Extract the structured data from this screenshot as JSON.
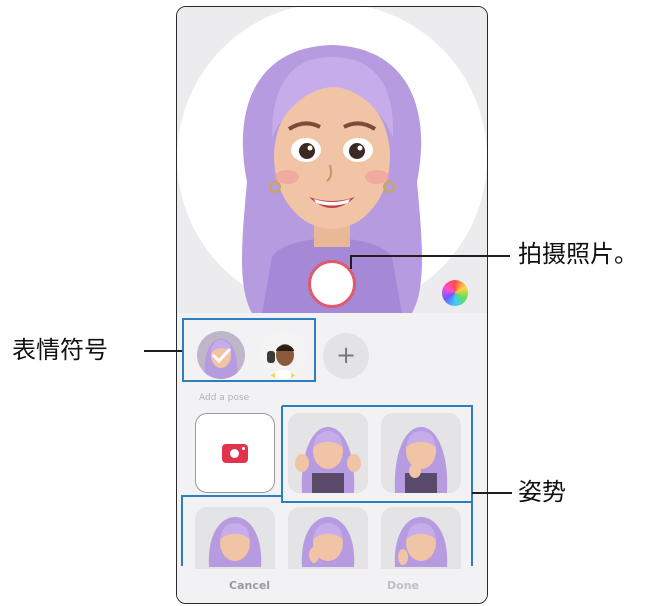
{
  "callouts": {
    "take_photo": "拍摄照片。",
    "emojis": "表情符号",
    "poses": "姿势"
  },
  "emoji_row": {
    "add_symbol": "+"
  },
  "section": {
    "add_label": "Add a pose"
  },
  "bottom_bar": {
    "cancel_label": "Cancel",
    "done_label": "Done"
  },
  "icons": {
    "camera": "camera-icon",
    "color_picker": "color-palette-icon",
    "shutter": "shutter-button",
    "check": "check-icon"
  },
  "colors": {
    "accent_blue": "#2b7fc1",
    "shutter_ring": "#e05a6e",
    "camera_red": "#e2334e",
    "hair_purple": "#b79be0"
  }
}
